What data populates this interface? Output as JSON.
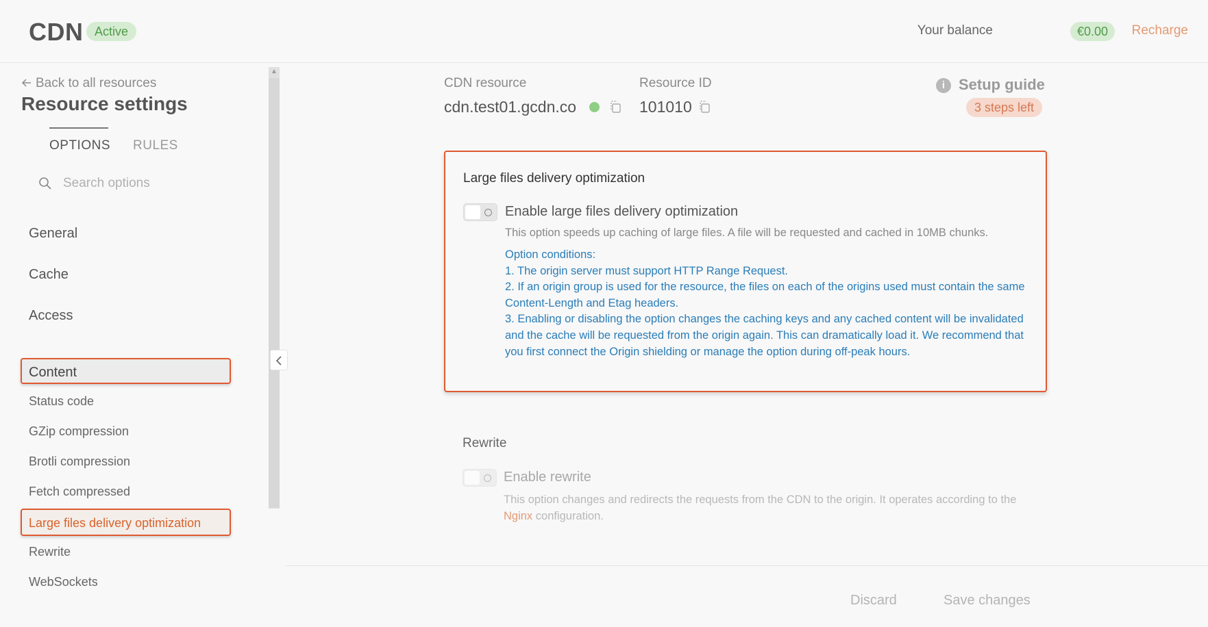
{
  "header": {
    "logo": "CDN",
    "status_badge": "Active",
    "balance_label": "Your balance",
    "balance_value": "€0.00",
    "recharge_label": "Recharge"
  },
  "sidebar": {
    "back_link": "Back to all resources",
    "title": "Resource settings",
    "tabs": [
      {
        "label": "OPTIONS",
        "active": true
      },
      {
        "label": "RULES",
        "active": false
      }
    ],
    "search_placeholder": "Search options",
    "sections": [
      "General",
      "Cache",
      "Access",
      "Content"
    ],
    "content_items": [
      "Status code",
      "GZip compression",
      "Brotli compression",
      "Fetch compressed",
      "Large files delivery optimization",
      "Rewrite",
      "WebSockets"
    ]
  },
  "resource": {
    "cdn_label": "CDN resource",
    "cdn_value": "cdn.test01.gcdn.co",
    "id_label": "Resource ID",
    "id_value": "101010"
  },
  "setup_guide": {
    "label": "Setup guide",
    "steps": "3 steps left"
  },
  "large_files": {
    "title": "Large files delivery optimization",
    "toggle_label": "Enable large files delivery optimization",
    "toggle_on": false,
    "description": "This option speeds up caching of large files. A file will be requested and cached in 10MB chunks.",
    "conditions": [
      "Option conditions:",
      "1. The origin server must support HTTP Range Request.",
      "2. If an origin group is used for the resource, the files on each of the origins used must contain the same Content-Length and Etag headers.",
      "3. Enabling or disabling the option changes the caching keys and any cached content will be invalidated and the cache will be requested from the origin again. This can dramatically load it. We recommend that you first connect the Origin shielding or manage the option during off-peak hours."
    ]
  },
  "rewrite": {
    "title": "Rewrite",
    "toggle_label": "Enable rewrite",
    "toggle_on": false,
    "description_before": "This option changes and redirects the requests from the CDN to the origin. It operates according to the ",
    "description_link": "Nginx",
    "description_after": " configuration."
  },
  "footer": {
    "discard_label": "Discard",
    "save_label": "Save changes"
  },
  "colors": {
    "accent": "#e05a2f",
    "link": "#2a7db8",
    "success": "#8fce85"
  }
}
